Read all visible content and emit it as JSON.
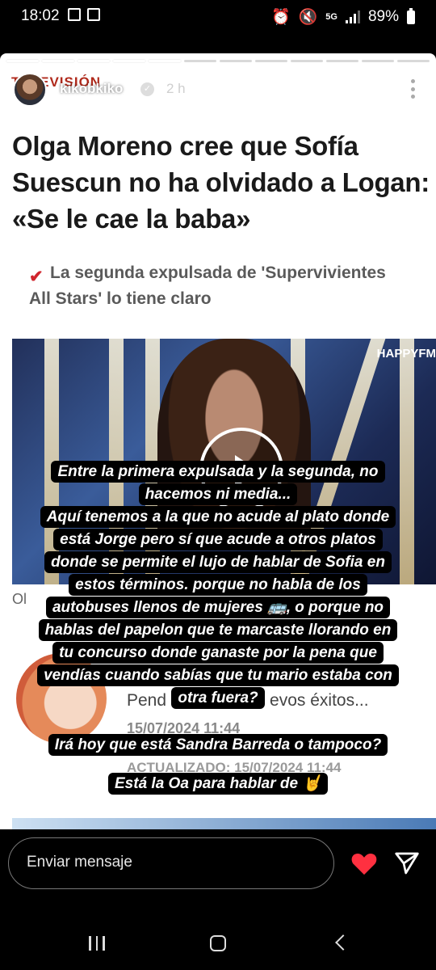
{
  "status_bar": {
    "time": "18:02",
    "network": "5G",
    "battery": "89%"
  },
  "story": {
    "brand": "TELEVISIÓN",
    "username": "kikobkiko",
    "time_ago": "2 h",
    "article": {
      "headline": "Olga Moreno cree que Sofía Suescun no ha olvidado a Logan: «Se le cae la baba»",
      "subtitle": "La segunda expulsada de 'Supervivientes All Stars' lo tiene claro",
      "video_logo": "HAPPYFM",
      "partial_text": "Ol",
      "comment_text": "Pend",
      "comment_text_2": "evos éxitos...",
      "date": "15/07/2024 11:44",
      "updated": "ACTUALIZADO: 15/07/2024 11:44"
    },
    "caption": {
      "lines": [
        "Entre la primera expulsada y la segunda, no",
        "hacemos ni media...",
        "Aquí tenemos a la que no acude al plato donde",
        "está Jorge pero sí que acude a otros platos",
        "donde se permite el lujo de hablar de Sofia en",
        "estos términos. porque no habla de los",
        "autobuses llenos de mujeres 🚌, o porque no",
        "hablas del papelon que te marcaste llorando en",
        "tu concurso donde ganaste por la pena que",
        "vendías cuando sabías que tu mario estaba con",
        "otra fuera?"
      ],
      "line_2": "Irá hoy que está Sandra Barreda o tampoco?",
      "line_3": "Está la Oa para hablar de 🤘"
    }
  },
  "reply": {
    "placeholder": "Enviar mensaje"
  },
  "icons": {
    "heart": "heart-icon",
    "send": "send-icon",
    "accent": "#ff3040"
  }
}
